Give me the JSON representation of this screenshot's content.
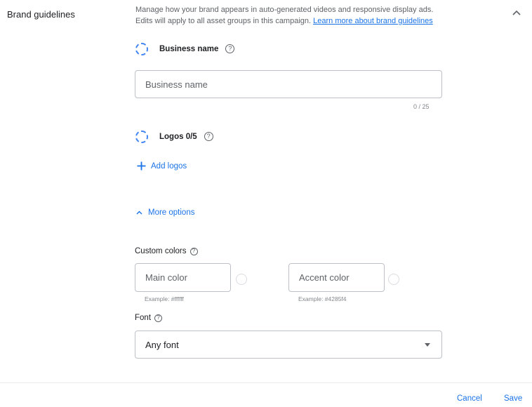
{
  "section": {
    "title": "Brand guidelines",
    "description_line1": "Manage how your brand appears in auto-generated videos and responsive display ads.",
    "description_line2": "Edits will apply to all asset groups in this campaign.",
    "learn_more_link": "Learn more about brand guidelines"
  },
  "business_name": {
    "heading": "Business name",
    "placeholder": "Business name",
    "counter": "0 / 25"
  },
  "logos": {
    "heading": "Logos 0/5",
    "add_label": "Add logos"
  },
  "more_options": {
    "label": "More options"
  },
  "custom_colors": {
    "label": "Custom colors",
    "main_placeholder": "Main color",
    "main_example": "Example: #ffffff",
    "accent_placeholder": "Accent color",
    "accent_example": "Example: #4285f4"
  },
  "font": {
    "label": "Font",
    "selected": "Any font"
  },
  "footer": {
    "cancel": "Cancel",
    "save": "Save"
  },
  "colors": {
    "accent": "#1a73e8",
    "ring": "#4285f4",
    "border": "#bdc1c6"
  }
}
